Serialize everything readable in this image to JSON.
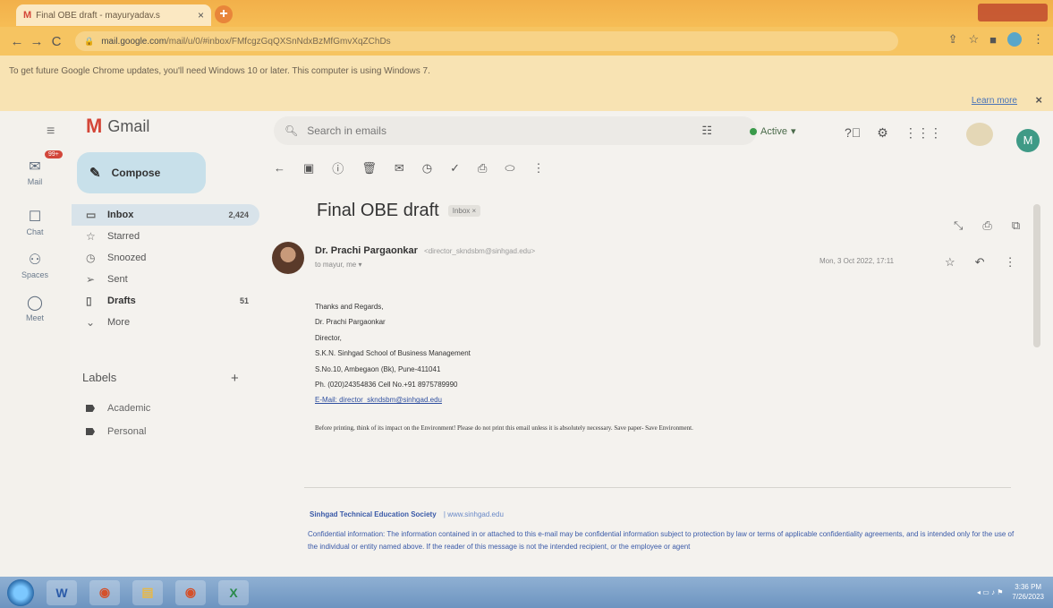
{
  "tab": {
    "title": "Final OBE draft - mayuryadav.s",
    "close": "×",
    "new": "+"
  },
  "addressbar": {
    "back": "←",
    "forward": "→",
    "reload": "C",
    "url_domain": "mail.google.com",
    "url_path": "/mail/u/0/#inbox/FMfcgzGqQXSnNdxBzMfGmvXqZChDs"
  },
  "infobar": {
    "message": "To get future Google Chrome updates, you'll need Windows 10 or later. This computer is using Windows 7.",
    "learn_more": "Learn more",
    "close": "×"
  },
  "rail": [
    {
      "label": "Mail",
      "icon": "mail-icon",
      "badge": "99+"
    },
    {
      "label": "Chat",
      "icon": "chat-icon"
    },
    {
      "label": "Spaces",
      "icon": "spaces-icon"
    },
    {
      "label": "Meet",
      "icon": "meet-icon"
    }
  ],
  "header": {
    "menu": "≡",
    "app_name": "Gmail",
    "search_placeholder": "Search in emails",
    "status": "Active",
    "avatar_letter": "M"
  },
  "compose_label": "Compose",
  "nav": [
    {
      "label": "Inbox",
      "count": "2,424",
      "icon": "inbox-icon",
      "active": true
    },
    {
      "label": "Starred",
      "count": "",
      "icon": "star-icon"
    },
    {
      "label": "Snoozed",
      "count": "",
      "icon": "clock-icon"
    },
    {
      "label": "Sent",
      "count": "",
      "icon": "send-icon"
    },
    {
      "label": "Drafts",
      "count": "51",
      "icon": "draft-icon"
    },
    {
      "label": "More",
      "count": "",
      "icon": "chevron-down-icon"
    }
  ],
  "labels": {
    "title": "Labels",
    "add": "+",
    "items": [
      "Academic",
      "Personal"
    ]
  },
  "message": {
    "subject": "Final OBE draft",
    "chip": "Inbox ×",
    "sender_name": "Dr. Prachi Pargaonkar",
    "sender_email": "<director_skndsbm@sinhgad.edu>",
    "to": "to mayur, me ▾",
    "date": "Mon, 3 Oct 2022, 17:11",
    "signature": [
      "Thanks and Regards,",
      "Dr. Prachi Pargaonkar",
      "Director,",
      "S.K.N. Sinhgad School of Business Management",
      "S.No.10, Ambegaon (Bk), Pune-411041",
      "Ph. (020)24354836 Cell No.+91 8975789990",
      "E-Mail: director_skndsbm@sinhgad.edu"
    ],
    "print_note": "Before printing, think of its impact on the Environment! Please do not print this email unless it is absolutely necessary. Save paper- Save Environment.",
    "society": "Sinhgad Technical Education Society",
    "society_site": "| www.sinhgad.edu",
    "confidential": "Confidential information: The information contained in or attached to this e-mail may be confidential information subject to protection by law or terms of applicable confidentiality agreements, and is intended only for the use of the individual or entity named above. If the reader of this message is not the intended recipient, or the employee or agent"
  },
  "taskbar": {
    "time": "3:36 PM",
    "date": "7/26/2023"
  }
}
